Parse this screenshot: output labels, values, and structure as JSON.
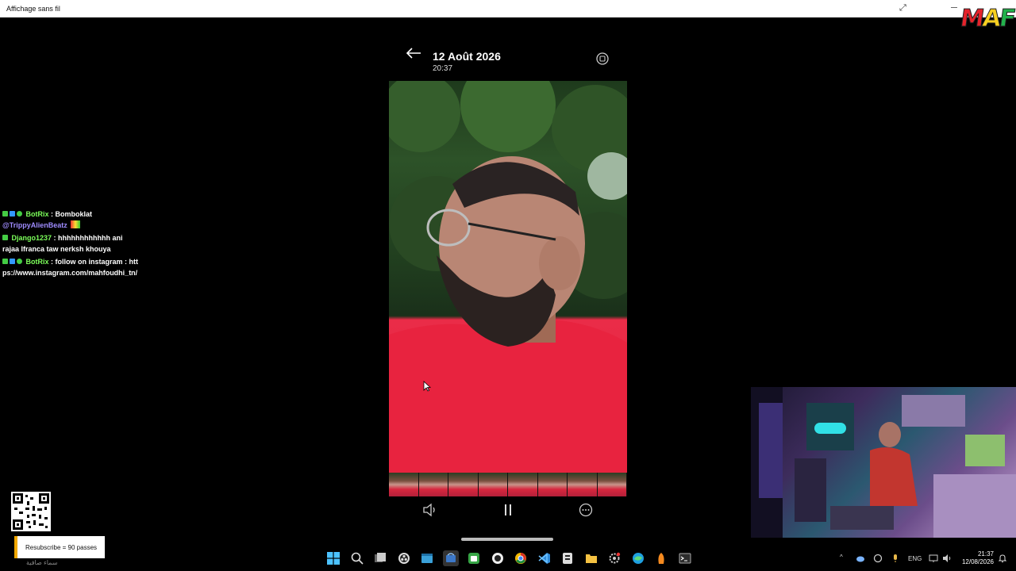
{
  "window": {
    "title": "Affichage sans fil"
  },
  "logo": {
    "text": "MAF"
  },
  "viewer": {
    "date": "12 Août 2026",
    "time": "20:37"
  },
  "chat": [
    {
      "user": "BotRix",
      "sep": " : ",
      "message": "Bomboklat",
      "mention": "@TrippyAlienBeatz"
    },
    {
      "user": "Django1237",
      "sep": " : ",
      "message": "hhhhhhhhhhhh ani rajaa lfranca taw nerksh khouya"
    },
    {
      "user": "BotRix",
      "sep": " : ",
      "message": "follow on instagram : https://www.instagram.com/mahfoudhi_tn/"
    }
  ],
  "notification": {
    "text": "Resubscribe = 90 passes"
  },
  "overlay": {
    "arabic_text": "سماء صافية"
  },
  "taskbar": {
    "tray_lang": "ENG",
    "clock_time": "21:37",
    "clock_date": "12/08/2026"
  },
  "colors": {
    "chat_user": "#7cff5a",
    "mention": "#9f8cff",
    "photo_shirt": "#e0213c",
    "notice_accent": "#f2a900"
  }
}
